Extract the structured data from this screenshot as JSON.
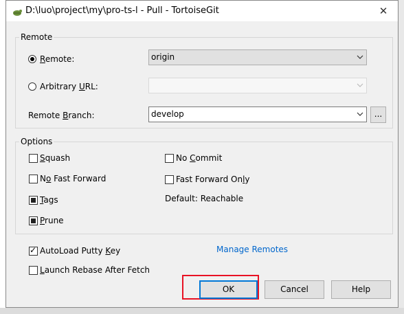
{
  "window": {
    "title": "D:\\luo\\project\\my\\pro-ts-l - Pull - TortoiseGit"
  },
  "remote_group": {
    "legend": "Remote",
    "remote_radio_pre": "",
    "remote_radio_u": "R",
    "remote_radio_post": "emote:",
    "remote_value": "origin",
    "url_radio_pre": "Arbitrary ",
    "url_radio_u": "U",
    "url_radio_post": "RL:",
    "url_value": "",
    "branch_label_pre": "Remote ",
    "branch_label_u": "B",
    "branch_label_post": "ranch:",
    "branch_value": "develop",
    "browse_label": "..."
  },
  "options_group": {
    "legend": "Options",
    "squash_u": "S",
    "squash_rest": "quash",
    "no_ff_pre": "N",
    "no_ff_u": "o",
    "no_ff_post": " Fast Forward",
    "tags_u": "T",
    "tags_rest": "ags",
    "prune_u": "P",
    "prune_rest": "rune",
    "no_commit_pre": "No ",
    "no_commit_u": "C",
    "no_commit_post": "ommit",
    "ff_only_pre": "Fast Forward On",
    "ff_only_u": "l",
    "ff_only_post": "y",
    "default_text": "Default: Reachable"
  },
  "bottom": {
    "autoload_pre": "AutoLoad Putty ",
    "autoload_u": "K",
    "autoload_post": "ey",
    "rebase_u": "L",
    "rebase_rest": "aunch Rebase After Fetch",
    "manage_remotes": "Manage Remotes",
    "ok": "OK",
    "cancel": "Cancel",
    "help": "Help"
  },
  "colors": {
    "accent": "#0078d7",
    "highlight": "#e81123",
    "link": "#0066cc"
  }
}
